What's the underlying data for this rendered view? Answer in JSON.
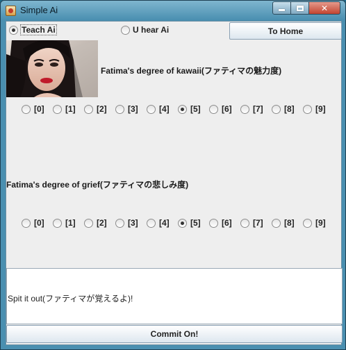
{
  "window": {
    "title": "Simple Ai"
  },
  "mode": {
    "teach_label": "Teach Ai",
    "hear_label": "U hear Ai",
    "selected": "teach"
  },
  "buttons": {
    "to_home": "To Home",
    "commit": "Commit On!"
  },
  "kawaii": {
    "label": "Fatima's degree of kawaii(ファティマの魅力度)",
    "options": [
      "[0]",
      "[1]",
      "[2]",
      "[3]",
      "[4]",
      "[5]",
      "[6]",
      "[7]",
      "[8]",
      "[9]"
    ],
    "selected_index": 5
  },
  "grief": {
    "label": "Fatima's degree of grief(ファティマの悲しみ度)",
    "options": [
      "[0]",
      "[1]",
      "[2]",
      "[3]",
      "[4]",
      "[5]",
      "[6]",
      "[7]",
      "[8]",
      "[9]"
    ],
    "selected_index": 5
  },
  "input": {
    "value": "Spit it out(ファティマが覚えるよ)!"
  },
  "colors": {
    "accent": "#4a8fb0",
    "close": "#c24530"
  }
}
